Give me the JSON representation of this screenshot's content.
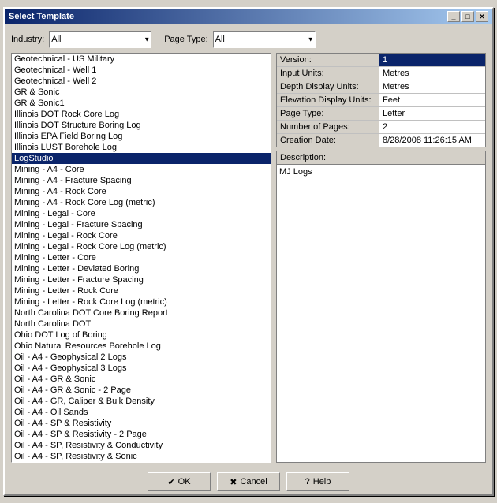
{
  "window": {
    "title": "Select Template",
    "title_buttons": [
      "_",
      "□",
      "✕"
    ]
  },
  "filters": {
    "industry_label": "Industry:",
    "industry_value": "All",
    "page_type_label": "Page Type:",
    "page_type_value": "All"
  },
  "list": {
    "items": [
      "Geotechnical - US Military",
      "Geotechnical - Well 1",
      "Geotechnical - Well 2",
      "GR & Sonic",
      "GR & Sonic1",
      "Illinois DOT Rock Core Log",
      "Illinois DOT Structure Boring Log",
      "Illinois EPA Field Boring Log",
      "Illinois LUST Borehole Log",
      "LogStudio",
      "Mining - A4 - Core",
      "Mining - A4 - Fracture Spacing",
      "Mining - A4 - Rock Core",
      "Mining - A4 - Rock Core Log (metric)",
      "Mining - Legal - Core",
      "Mining - Legal - Fracture Spacing",
      "Mining - Legal - Rock Core",
      "Mining - Legal - Rock Core Log (metric)",
      "Mining - Letter - Core",
      "Mining - Letter - Deviated Boring",
      "Mining - Letter - Fracture Spacing",
      "Mining - Letter - Rock Core",
      "Mining - Letter - Rock Core Log (metric)",
      "North Carolina DOT Core Boring Report",
      "North Carolina DOT",
      "Ohio DOT Log of Boring",
      "Ohio Natural Resources Borehole Log",
      "Oil - A4 - Geophysical 2 Logs",
      "Oil - A4 - Geophysical 3 Logs",
      "Oil - A4 - GR & Sonic",
      "Oil - A4 - GR & Sonic - 2 Page",
      "Oil - A4 - GR, Caliper & Bulk Density",
      "Oil - A4 - Oil Sands",
      "Oil - A4 - SP & Resistivity",
      "Oil - A4 - SP & Resistivity - 2 Page",
      "Oil - A4 - SP, Resistivity & Conductivity",
      "Oil - A4 - SP, Resistivity & Sonic"
    ],
    "selected_index": 9,
    "selected_value": "LogStudio"
  },
  "info": {
    "version_label": "Version:",
    "version_value": "1",
    "input_units_label": "Input Units:",
    "input_units_value": "Metres",
    "depth_display_label": "Depth Display Units:",
    "depth_display_value": "Metres",
    "elevation_display_label": "Elevation Display Units:",
    "elevation_display_value": "Feet",
    "page_type_label": "Page Type:",
    "page_type_value": "Letter",
    "num_pages_label": "Number of Pages:",
    "num_pages_value": "2",
    "creation_date_label": "Creation Date:",
    "creation_date_value": "8/28/2008 11:26:15 AM"
  },
  "description": {
    "label": "Description:",
    "content": "MJ Logs"
  },
  "buttons": {
    "ok_label": "OK",
    "cancel_label": "Cancel",
    "help_label": "Help"
  }
}
